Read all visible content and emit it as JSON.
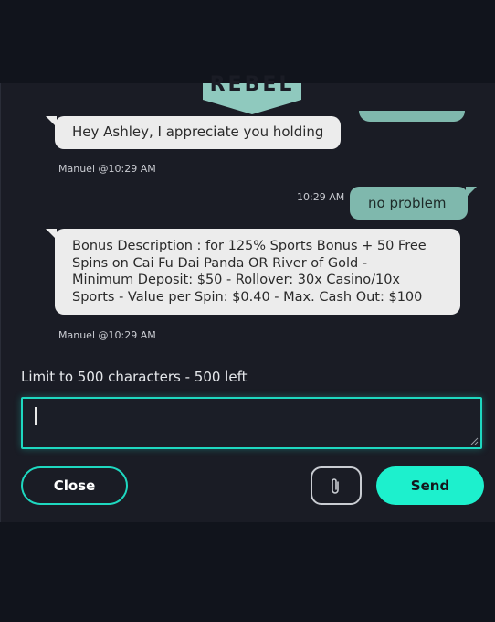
{
  "brand": {
    "logo_text": "REBEL",
    "accent": "#1ed8c0",
    "send_color": "#1df0cd",
    "outgoing_bubble": "#7fb8ad",
    "incoming_bubble": "#ececec"
  },
  "messages": [
    {
      "direction": "incoming",
      "text": "Hey Ashley, I appreciate you holding",
      "meta": "Manuel @10:29 AM"
    },
    {
      "direction": "outgoing",
      "text": "no problem",
      "time": "10:29 AM"
    },
    {
      "direction": "incoming",
      "lines": [
        "Bonus Description : for 125% Sports Bonus + 50 Free",
        "Spins on Cai Fu Dai Panda OR River of Gold -",
        "Minimum Deposit: $50 - Rollover: 30x Casino/10x",
        "Sports - Value per Spin: $0.40 - Max. Cash Out: $100"
      ],
      "meta": "Manuel @10:29 AM"
    }
  ],
  "composer": {
    "limit_text": "Limit to 500 characters - 500 left",
    "value": ""
  },
  "buttons": {
    "close_label": "Close",
    "attach_icon": "paperclip-icon",
    "send_label": "Send"
  }
}
